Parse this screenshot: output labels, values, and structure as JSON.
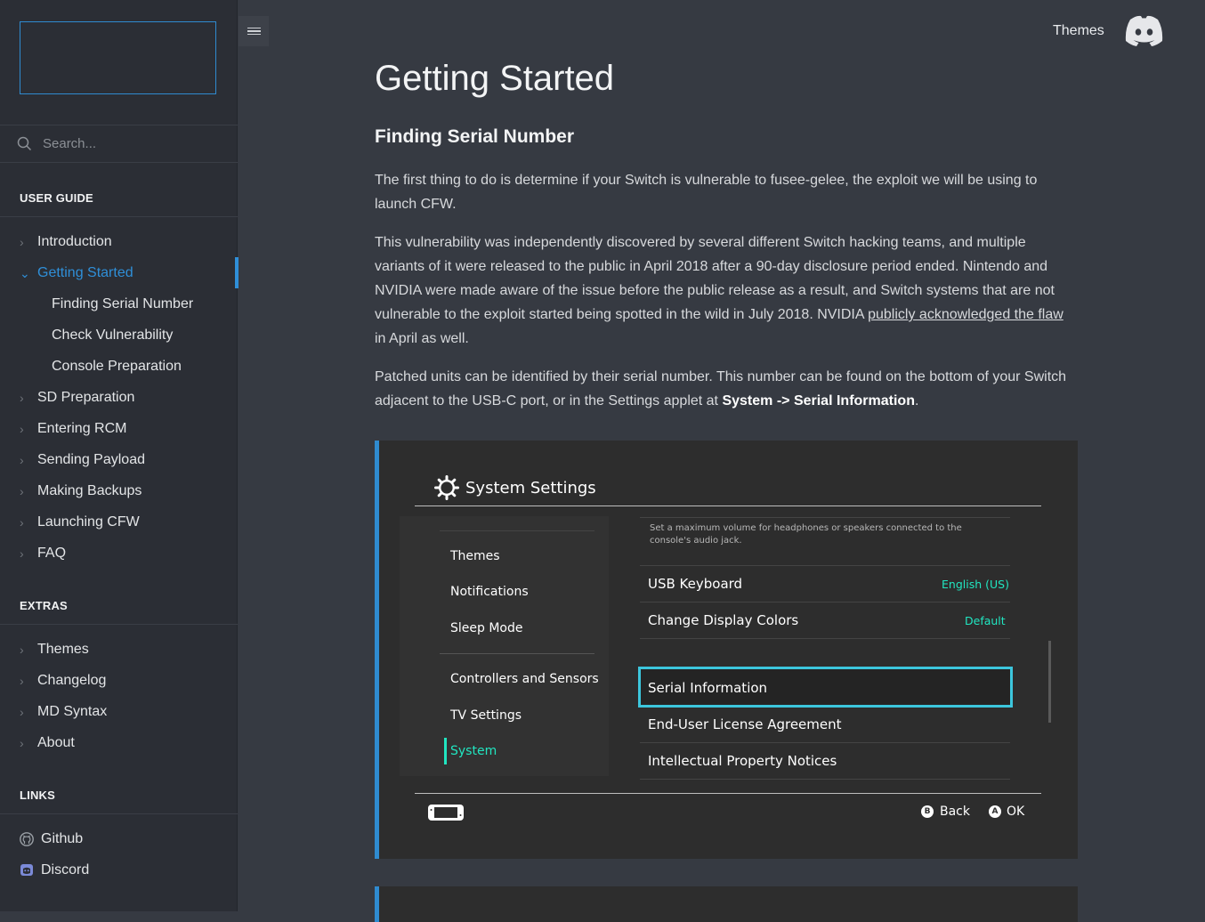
{
  "sidebar": {
    "search_placeholder": "Search...",
    "sections": {
      "user_guide": "USER GUIDE",
      "extras": "EXTRAS",
      "links": "LINKS"
    },
    "user_guide_items": [
      "Introduction",
      "Getting Started",
      "Finding Serial Number",
      "Check Vulnerability",
      "Console Preparation",
      "SD Preparation",
      "Entering RCM",
      "Sending Payload",
      "Making Backups",
      "Launching CFW",
      "FAQ"
    ],
    "extras_items": [
      "Themes",
      "Changelog",
      "MD Syntax",
      "About"
    ],
    "link_items": [
      "Github",
      "Discord"
    ]
  },
  "header": {
    "themes_link": "Themes"
  },
  "content": {
    "title": "Getting Started",
    "subtitle": "Finding Serial Number",
    "p1": "The first thing to do is determine if your Switch is vulnerable to fusee-gelee, the exploit we will be using to launch CFW.",
    "p2_a": "This vulnerability was independently discovered by several different Switch hacking teams, and multiple variants of it were released to the public in April 2018 after a 90-day disclosure period ended. Nintendo and NVIDIA were made aware of the issue before the public release as a result, and Switch systems that are not vulnerable to the exploit started being spotted in the wild in July 2018. NVIDIA ",
    "p2_link": "publicly acknowledged the flaw",
    "p2_b": " in April as well.",
    "p3_a": "Patched units can be identified by their serial number. This number can be found on the bottom of your Switch adjacent to the USB-C port, or in the Settings applet at ",
    "p3_bold": "System -> Serial Information",
    "p3_b": "."
  },
  "switch_screen": {
    "title": "System Settings",
    "menu": [
      "Themes",
      "Notifications",
      "Sleep Mode",
      "Controllers and Sensors",
      "TV Settings",
      "System"
    ],
    "top_note": "Set a maximum volume for headphones or speakers connected to the console's audio jack.",
    "rows": [
      {
        "label": "USB Keyboard",
        "value": "English (US)"
      },
      {
        "label": "Change Display Colors",
        "value": "Default"
      },
      {
        "label": "Serial Information",
        "value": ""
      },
      {
        "label": "End-User License Agreement",
        "value": ""
      },
      {
        "label": "Intellectual Property Notices",
        "value": ""
      }
    ],
    "footer_back_btn": "B",
    "footer_back": "Back",
    "footer_ok_btn": "A",
    "footer_ok": "OK"
  },
  "colors": {
    "accent": "#2f8fd8",
    "switch_highlight": "#3cc6dd",
    "switch_green": "#21e6c1"
  }
}
